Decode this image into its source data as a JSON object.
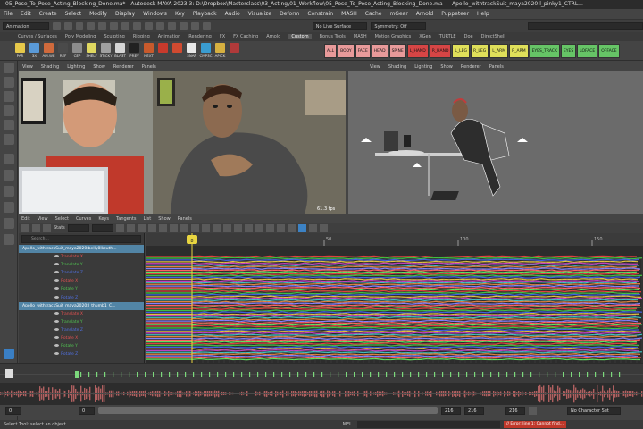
{
  "window": {
    "title": "05_Pose_To_Pose_Acting_Blocking_Done.ma* - Autodesk MAYA 2023.3: D:\\Dropbox\\Masterclass\\03_Acting\\01_Workflow\\05_Pose_To_Pose_Acting_Blocking_Done.ma  ---  Apollo_withtrackSuit_maya2020:l_pinky1_CTRL..."
  },
  "menu": [
    "File",
    "Edit",
    "Create",
    "Select",
    "Modify",
    "Display",
    "Windows",
    "Key",
    "Playback",
    "Audio",
    "Visualize",
    "Deform",
    "Constrain",
    "MASH",
    "Cache",
    "mGear",
    "Arnold",
    "Puppeteer",
    "Help"
  ],
  "status_line": {
    "menuset": "Animation",
    "live_surface": "No Live Surface",
    "symmetry": "Symmetry: Off"
  },
  "shelf_tabs": [
    "Curves / Surfaces",
    "Poly Modeling",
    "Sculpting",
    "Rigging",
    "Animation",
    "Rendering",
    "FX",
    "FX Caching",
    "Arnold",
    "Custom",
    "Bonus Tools",
    "MASH",
    "Motion Graphics",
    "XGen",
    "TURTLE",
    "Doe",
    "DirectShell"
  ],
  "shelf_tabs_active": "Custom",
  "shelf_tools": [
    {
      "label": "PAR",
      "color": "#e6c84a"
    },
    {
      "label": "3X",
      "color": "#5a9ad8"
    },
    {
      "label": "AM.WE",
      "color": "#d06a3c"
    },
    {
      "label": "REF",
      "color": "#4a4a4a"
    },
    {
      "label": "CEP",
      "color": "#8c8c8c"
    },
    {
      "label": "SHELF",
      "color": "#e0d860"
    },
    {
      "label": "STICKY",
      "color": "#a0a0a0"
    },
    {
      "label": "BLAST",
      "color": "#d6d6d6"
    },
    {
      "label": "PREV",
      "color": "#222222"
    },
    {
      "label": "NEXT",
      "color": "#c85a2c"
    },
    {
      "label": "",
      "color": "#c83a2c"
    },
    {
      "label": "",
      "color": "#d04a30"
    },
    {
      "label": "SNAP",
      "color": "#e8e8e8"
    },
    {
      "label": "CMPSC",
      "color": "#3a9cd0"
    },
    {
      "label": "APICK",
      "color": "#d6b040"
    },
    {
      "label": "",
      "color": "#b03a3a"
    }
  ],
  "picker_buttons": [
    {
      "label": "ALL",
      "color": "#e89a9a"
    },
    {
      "label": "BODY",
      "color": "#e89a9a"
    },
    {
      "label": "FACE",
      "color": "#e89a9a"
    },
    {
      "label": "HEAD",
      "color": "#e89a9a"
    },
    {
      "label": "SPINE",
      "color": "#e89a9a"
    },
    {
      "label": "L_HAND",
      "color": "#d64545"
    },
    {
      "label": "R_HAND",
      "color": "#d64545"
    },
    {
      "label": "L_LEG",
      "color": "#e0e05a"
    },
    {
      "label": "R_LEG",
      "color": "#e0e05a"
    },
    {
      "label": "L_ARM",
      "color": "#e0e05a"
    },
    {
      "label": "R_ARM",
      "color": "#e0e05a"
    },
    {
      "label": "EYES_TRACK",
      "color": "#66c466"
    },
    {
      "label": "EYES",
      "color": "#66c466"
    },
    {
      "label": "LOFACE",
      "color": "#66c466"
    },
    {
      "label": "OFFACE",
      "color": "#66c466"
    }
  ],
  "viewport_left": {
    "menus": [
      "View",
      "Shading",
      "Lighting",
      "Show",
      "Renderer",
      "Panels"
    ],
    "fps": "61.3 fps"
  },
  "viewport_right": {
    "menus": [
      "View",
      "Shading",
      "Lighting",
      "Show",
      "Renderer",
      "Panels"
    ]
  },
  "graph_editor": {
    "menus": [
      "Edit",
      "View",
      "Select",
      "Curves",
      "Keys",
      "Tangents",
      "List",
      "Show",
      "Panels"
    ],
    "stats_label": "Stats",
    "search_placeholder": "Search...",
    "outliner": [
      {
        "label": "Apollo_withtrackSuit_maya2020:belly8Ikcuth...",
        "type": "header"
      },
      {
        "label": "Translate X",
        "color": "#e05050"
      },
      {
        "label": "Translate Y",
        "color": "#50c050"
      },
      {
        "label": "Translate Z",
        "color": "#5070e0"
      },
      {
        "label": "Rotate X",
        "color": "#e05050"
      },
      {
        "label": "Rotate Y",
        "color": "#50c050"
      },
      {
        "label": "Rotate Z",
        "color": "#5070e0"
      },
      {
        "label": "Apollo_withtrackSuit_maya2020:l_thumb1_C...",
        "type": "header"
      },
      {
        "label": "Translate X",
        "color": "#e05050"
      },
      {
        "label": "Translate Y",
        "color": "#50c050"
      },
      {
        "label": "Translate Z",
        "color": "#5070e0"
      },
      {
        "label": "Rotate X",
        "color": "#e05050"
      },
      {
        "label": "Rotate Y",
        "color": "#50c050"
      },
      {
        "label": "Rotate Z",
        "color": "#5070e0"
      }
    ],
    "ruler": [
      {
        "frame": "0"
      },
      {
        "frame": "50"
      },
      {
        "frame": "100"
      },
      {
        "frame": "150"
      }
    ],
    "current_frame": "8"
  },
  "range": {
    "start": "0",
    "start_inner": "0",
    "end_inner": "216",
    "end_a": "216",
    "end_b": "216"
  },
  "right_fields": {
    "char": "No Character Set",
    "error": "// Error: line 1: Cannot find..."
  },
  "help_line": "Select Tool: select an object",
  "cmd_label": "MEL"
}
